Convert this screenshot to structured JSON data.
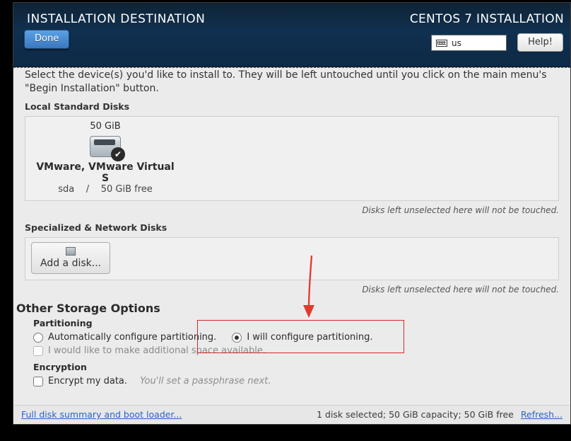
{
  "header": {
    "title": "INSTALLATION DESTINATION",
    "subtitle": "CENTOS 7 INSTALLATION",
    "done": "Done",
    "keyboard": "us",
    "help": "Help!"
  },
  "intro_line1": "Select the device(s) you'd like to install to.  They will be left untouched until you click on the main menu's",
  "intro_line2": "\"Begin Installation\" button.",
  "local_disks_title": "Local Standard Disks",
  "disk": {
    "size": "50 GiB",
    "name": "VMware, VMware Virtual S",
    "device": "sda",
    "sep": "/",
    "free": "50 GiB free"
  },
  "hint": "Disks left unselected here will not be touched.",
  "network_disks_title": "Specialized & Network Disks",
  "add_disk": "Add a disk...",
  "other_title": "Other Storage Options",
  "partitioning": {
    "label": "Partitioning",
    "auto": "Automatically configure partitioning.",
    "manual": "I will configure partitioning.",
    "extra": "I would like to make additional space available."
  },
  "encryption": {
    "label": "Encryption",
    "encrypt": "Encrypt my data.",
    "note": "You'll set a passphrase next."
  },
  "footer": {
    "summary": "Full disk summary and boot loader...",
    "status": "1 disk selected; 50 GiB capacity; 50 GiB free",
    "refresh": "Refresh..."
  }
}
